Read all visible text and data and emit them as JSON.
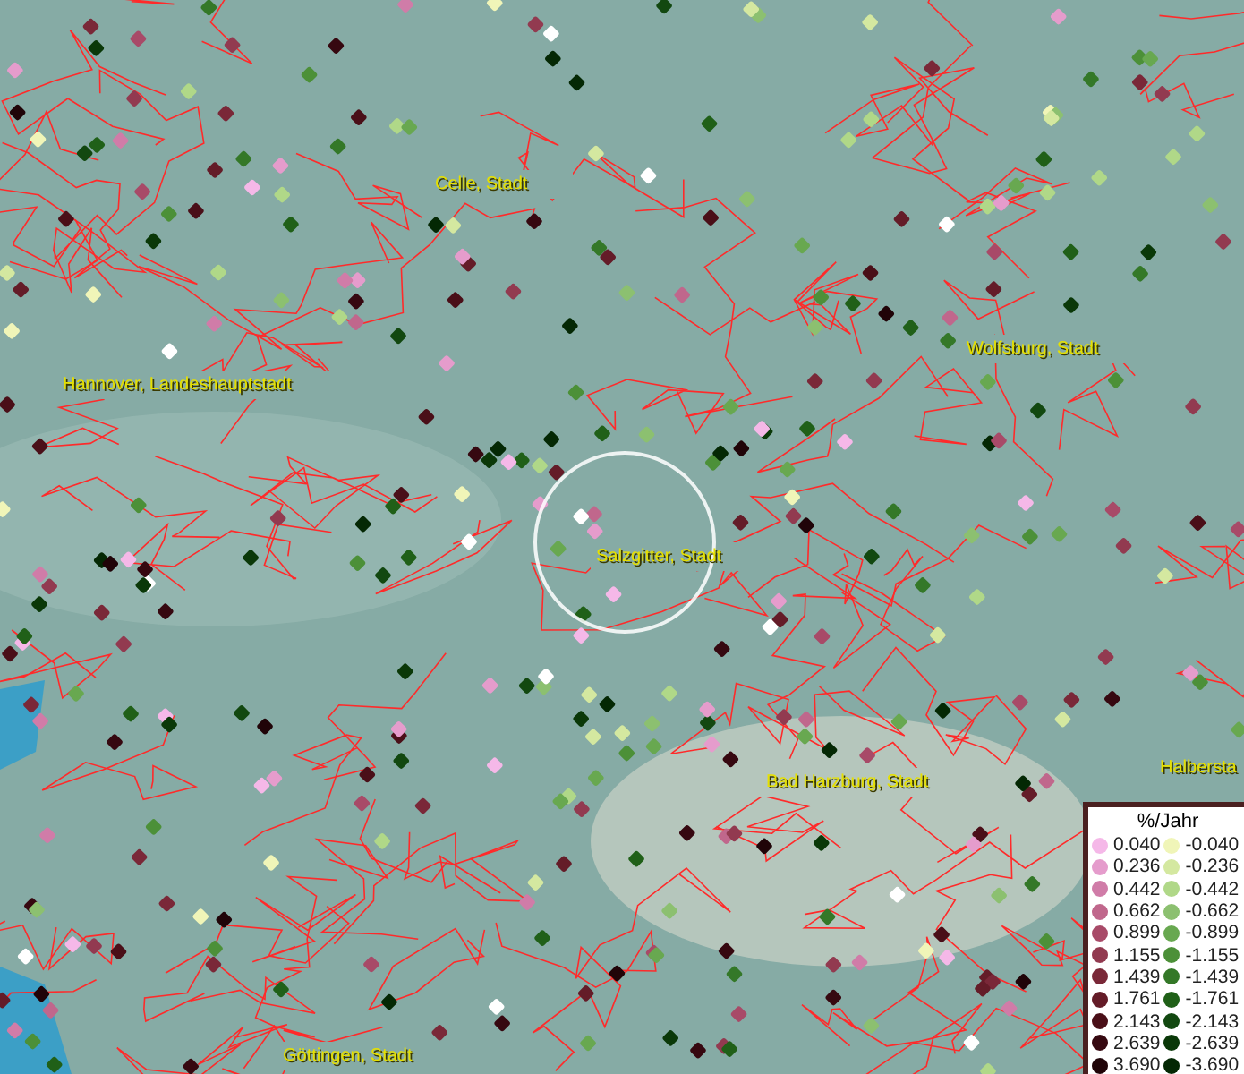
{
  "map": {
    "places": [
      {
        "name": "Celle, Stadt"
      },
      {
        "name": "Hannover, Landeshauptstadt"
      },
      {
        "name": "Wolfsburg, Stadt"
      },
      {
        "name": "Salzgitter, Stadt"
      },
      {
        "name": "Bad Harzburg, Stadt"
      },
      {
        "name": "Halbersta"
      },
      {
        "name": "Göttingen, Stadt"
      }
    ]
  },
  "legend": {
    "title": "%/Jahr",
    "columns": [
      [
        {
          "label": "0.040",
          "color": "#f5b8e8"
        },
        {
          "label": "0.236",
          "color": "#e59ccc"
        },
        {
          "label": "0.442",
          "color": "#d07ca8"
        },
        {
          "label": "0.662",
          "color": "#c0678c"
        },
        {
          "label": "0.899",
          "color": "#a84a68"
        },
        {
          "label": "1.155",
          "color": "#923a50"
        },
        {
          "label": "1.439",
          "color": "#7a2838"
        },
        {
          "label": "1.761",
          "color": "#641c28"
        },
        {
          "label": "2.143",
          "color": "#4a0f18"
        },
        {
          "label": "2.639",
          "color": "#360810"
        },
        {
          "label": "3.690",
          "color": "#200408"
        }
      ],
      [
        {
          "label": "-0.040",
          "color": "#f0f5b8"
        },
        {
          "label": "-0.236",
          "color": "#d4e8a0"
        },
        {
          "label": "-0.442",
          "color": "#b0d888"
        },
        {
          "label": "-0.662",
          "color": "#8cc070"
        },
        {
          "label": "-0.899",
          "color": "#68a850"
        },
        {
          "label": "-1.155",
          "color": "#4c9038"
        },
        {
          "label": "-1.439",
          "color": "#347828"
        },
        {
          "label": "-1.761",
          "color": "#206018"
        },
        {
          "label": "-2.143",
          "color": "#124810"
        },
        {
          "label": "-2.639",
          "color": "#0a3808"
        },
        {
          "label": "-3.690",
          "color": "#042804"
        }
      ]
    ]
  }
}
